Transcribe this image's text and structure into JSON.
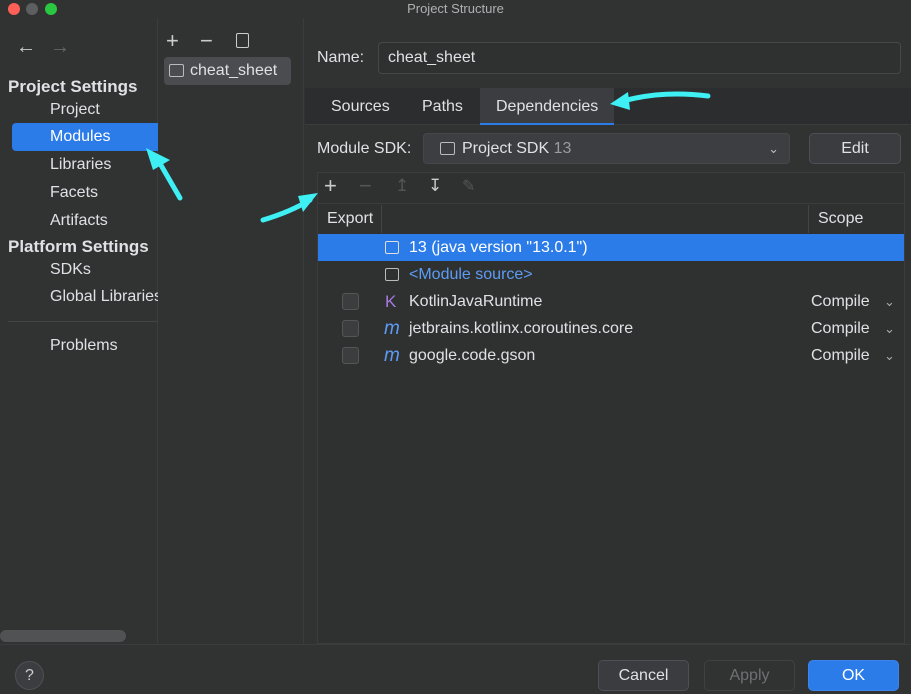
{
  "window": {
    "title": "Project Structure"
  },
  "sidebar": {
    "back_icon": "arrow-left-icon",
    "forward_icon": "arrow-right-icon",
    "sections": [
      {
        "title": "Project Settings",
        "items": [
          {
            "label": "Project"
          },
          {
            "label": "Modules",
            "selected": true
          },
          {
            "label": "Libraries"
          },
          {
            "label": "Facets"
          },
          {
            "label": "Artifacts"
          }
        ]
      },
      {
        "title": "Platform Settings",
        "items": [
          {
            "label": "SDKs"
          },
          {
            "label": "Global Libraries"
          }
        ]
      }
    ],
    "problems": "Problems"
  },
  "modules": {
    "items": [
      {
        "label": "cheat_sheet",
        "icon": "module-folder-icon"
      }
    ]
  },
  "main": {
    "name_label": "Name:",
    "name_value": "cheat_sheet",
    "tabs": [
      {
        "label": "Sources"
      },
      {
        "label": "Paths"
      },
      {
        "label": "Dependencies",
        "selected": true
      }
    ],
    "sdk_label": "Module SDK:",
    "sdk_value": "Project SDK",
    "sdk_version": "13",
    "edit_label": "Edit",
    "columns": {
      "export": "Export",
      "scope": "Scope"
    },
    "rows": [
      {
        "name": "13 (java version \"13.0.1\")",
        "icon": "jdk-folder-icon",
        "selected": true
      },
      {
        "name": "<Module source>",
        "icon": "source-folder-icon"
      },
      {
        "name": "KotlinJavaRuntime",
        "icon": "kotlin-icon",
        "scope": "Compile",
        "export": false
      },
      {
        "name": "jetbrains.kotlinx.coroutines.core",
        "icon": "maven-icon",
        "scope": "Compile",
        "export": false
      },
      {
        "name": "google.code.gson",
        "icon": "maven-icon",
        "scope": "Compile",
        "export": false
      }
    ]
  },
  "footer": {
    "help": "?",
    "cancel": "Cancel",
    "apply": "Apply",
    "ok": "OK"
  },
  "colors": {
    "accent": "#2b7be8",
    "annotation": "#3ef0f4",
    "link": "#5c9cf5"
  }
}
